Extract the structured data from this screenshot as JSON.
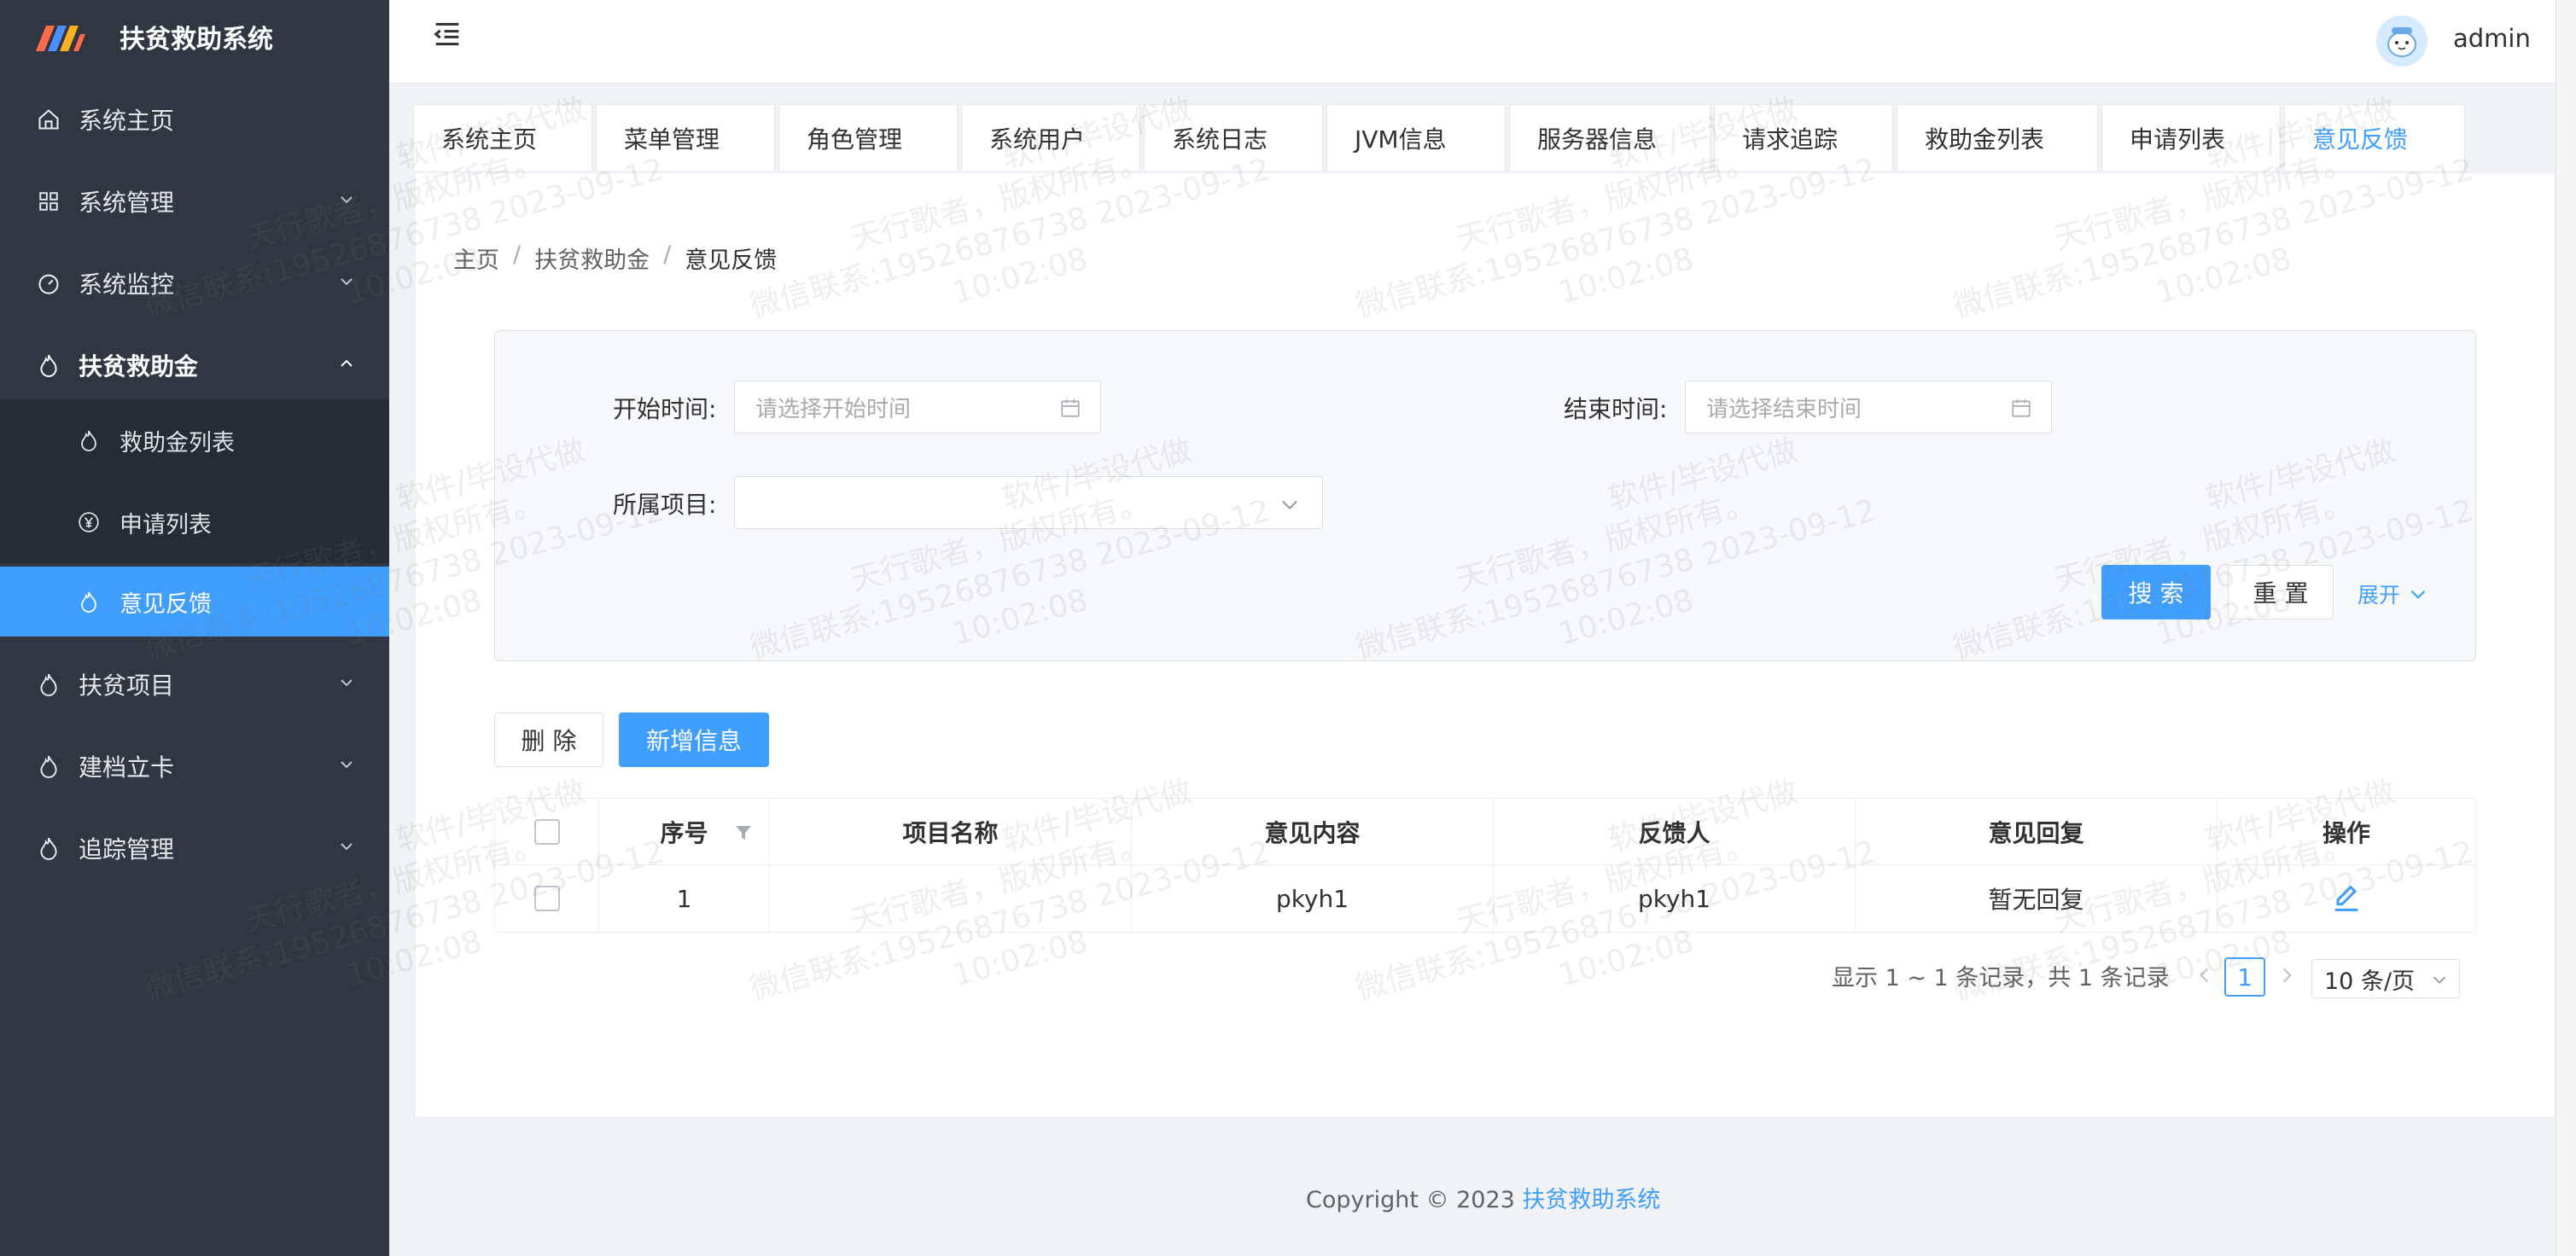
{
  "app": {
    "title": "扶贫救助系统",
    "copyright_prefix": "Copyright © 2023",
    "copyright_brand": "扶贫救助系统"
  },
  "header": {
    "username": "admin"
  },
  "sidebar": {
    "items": [
      {
        "label": "系统主页",
        "icon": "home-icon"
      },
      {
        "label": "系统管理",
        "icon": "grid-icon"
      },
      {
        "label": "系统监控",
        "icon": "gauge-icon"
      },
      {
        "label": "扶贫救助金",
        "icon": "flame-icon",
        "expanded": true,
        "children": [
          {
            "label": "救助金列表",
            "icon": "flame-icon"
          },
          {
            "label": "申请列表",
            "icon": "yen-icon"
          },
          {
            "label": "意见反馈",
            "icon": "flame-icon",
            "active": true
          }
        ]
      },
      {
        "label": "扶贫项目",
        "icon": "flame-icon"
      },
      {
        "label": "建档立卡",
        "icon": "flame-icon"
      },
      {
        "label": "追踪管理",
        "icon": "flame-icon"
      }
    ]
  },
  "tabs": [
    "系统主页",
    "菜单管理",
    "角色管理",
    "系统用户",
    "系统日志",
    "JVM信息",
    "服务器信息",
    "请求追踪",
    "救助金列表",
    "申请列表",
    "意见反馈"
  ],
  "breadcrumb": {
    "home": "主页",
    "parent": "扶贫救助金",
    "current": "意见反馈",
    "separator": "/"
  },
  "search": {
    "start_label": "开始时间:",
    "start_placeholder": "请选择开始时间",
    "end_label": "结束时间:",
    "end_placeholder": "请选择结束时间",
    "project_label": "所属项目:",
    "project_value": "",
    "search_button": "搜 索",
    "reset_button": "重 置",
    "expand_link": "展开"
  },
  "toolbar": {
    "delete_button": "删 除",
    "add_button": "新增信息"
  },
  "table": {
    "columns": [
      "",
      "序号",
      "项目名称",
      "意见内容",
      "反馈人",
      "意见回复",
      "操作"
    ],
    "rows": [
      {
        "index": "1",
        "project": "",
        "content": "pkyh1",
        "user": "pkyh1",
        "reply": "暂无回复"
      }
    ]
  },
  "pagination": {
    "summary": "显示 1 ~ 1 条记录，共 1 条记录",
    "current_page": "1",
    "page_size": "10 条/页"
  },
  "watermark": {
    "line1": "软件/毕设代做",
    "line2": "天行歌者，版权所有。",
    "line3": "微信联系:19526876738 2023-09-12",
    "line4": "10:02:08"
  },
  "colors": {
    "sidebar_bg": "#303742",
    "accent": "#409eff",
    "page_bg": "#f0f2f5"
  }
}
